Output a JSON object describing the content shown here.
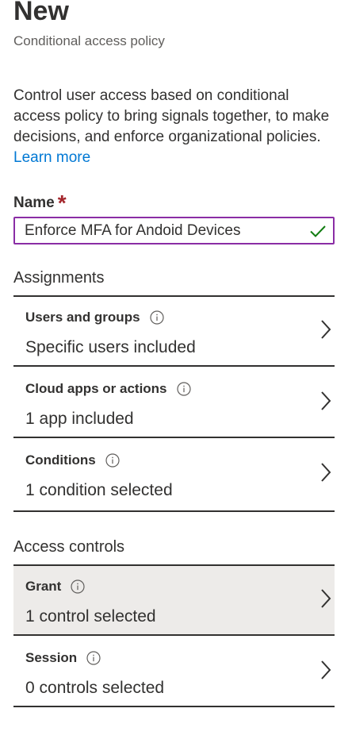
{
  "header": {
    "title": "New",
    "subtitle": "Conditional access policy"
  },
  "description": {
    "text": "Control user access based on conditional access policy to bring signals together, to make decisions, and enforce organizational policies. ",
    "link_label": "Learn more"
  },
  "name_field": {
    "label": "Name",
    "required_marker": "*",
    "value": "Enforce MFA for Andoid Devices",
    "valid": true
  },
  "assignments": {
    "heading": "Assignments",
    "items": [
      {
        "title": "Users and groups",
        "value": "Specific users included"
      },
      {
        "title": "Cloud apps or actions",
        "value": "1 app included"
      },
      {
        "title": "Conditions",
        "value": "1 condition selected"
      }
    ]
  },
  "access_controls": {
    "heading": "Access controls",
    "items": [
      {
        "title": "Grant",
        "value": "1 control selected",
        "selected": true
      },
      {
        "title": "Session",
        "value": "0 controls selected",
        "selected": false
      }
    ]
  },
  "colors": {
    "accent_link": "#0078d4",
    "required": "#a4262c",
    "field_border": "#8a2da5",
    "valid_check": "#107c10",
    "selected_row_bg": "#edebe9"
  },
  "icons": {
    "info": "info-icon",
    "chevron": "chevron-right-icon",
    "check": "checkmark-icon"
  }
}
